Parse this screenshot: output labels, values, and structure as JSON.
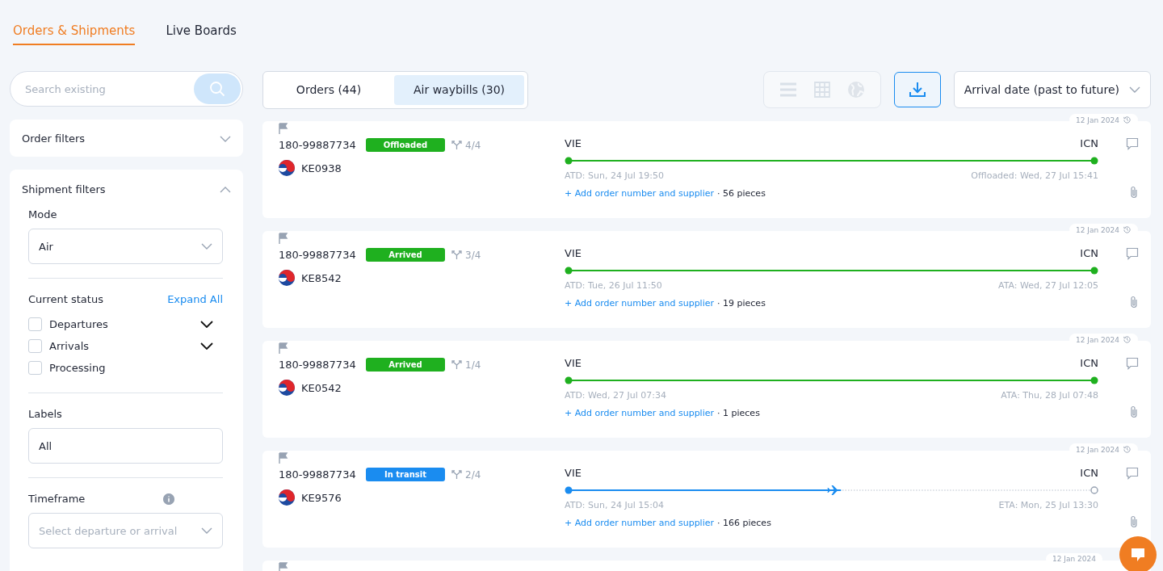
{
  "top_tabs": [
    {
      "label": "Orders & Shipments",
      "selected": true
    },
    {
      "label": "Live Boards",
      "selected": false
    }
  ],
  "search": {
    "placeholder": "Search existing"
  },
  "order_filters": {
    "title": "Order filters",
    "expanded": false
  },
  "shipment_filters": {
    "title": "Shipment filters",
    "expanded": true,
    "mode": {
      "label": "Mode",
      "value": "Air"
    },
    "current_status": {
      "label": "Current status",
      "expand_all": "Expand All",
      "options": [
        {
          "label": "Departures",
          "checked": false,
          "expandable": true
        },
        {
          "label": "Arrivals",
          "checked": false,
          "expandable": true
        },
        {
          "label": "Processing",
          "checked": false,
          "expandable": false
        }
      ]
    },
    "labels": {
      "label": "Labels",
      "value": "All"
    },
    "timeframe": {
      "label": "Timeframe",
      "placeholder": "Select departure or arrival"
    }
  },
  "view_tabs": [
    {
      "label": "Orders (44)",
      "selected": false
    },
    {
      "label": "Air waybills (30)",
      "selected": true
    }
  ],
  "sort": {
    "value": "Arrival date (past to future)"
  },
  "shipments": [
    {
      "awb": "180-99887734",
      "status": "Offloaded",
      "color": "#1fb01f",
      "legs": "4/4",
      "flight": "KE0938",
      "origin": "VIE",
      "destination": "ICN",
      "level": 1,
      "departure": "ATD: Sun, 24 Jul 19:50",
      "arrival": "Offloaded: Wed, 27 Jul 15:41",
      "add_link": "+ Add order number and supplier",
      "pieces": "· 56 pieces",
      "date": "12 Jan 2024"
    },
    {
      "awb": "180-99887734",
      "status": "Arrived",
      "color": "#1fb01f",
      "legs": "3/4",
      "flight": "KE8542",
      "origin": "VIE",
      "destination": "ICN",
      "level": 1,
      "departure": "ATD: Tue, 26 Jul 11:50",
      "arrival": "ATA: Wed, 27 Jul 12:05",
      "add_link": "+ Add order number and supplier",
      "pieces": "· 19 pieces",
      "date": "12 Jan 2024"
    },
    {
      "awb": "180-99887734",
      "status": "Arrived",
      "color": "#1fb01f",
      "legs": "1/4",
      "flight": "KE0542",
      "origin": "VIE",
      "destination": "ICN",
      "level": 1,
      "departure": "ATD: Wed, 27 Jul 07:34",
      "arrival": "ATA: Thu, 28 Jul 07:48",
      "add_link": "+ Add order number and supplier",
      "pieces": "· 1 pieces",
      "date": "12 Jan 2024"
    },
    {
      "awb": "180-99887734",
      "status": "In transit",
      "color": "#1a8cf0",
      "legs": "2/4",
      "flight": "KE9576",
      "origin": "VIE",
      "destination": "ICN",
      "level": 0.5,
      "departure": "ATD: Sun, 24 Jul 15:04",
      "arrival": "ETA: Mon, 25 Jul 13:30",
      "add_link": "+ Add order number and supplier",
      "pieces": "· 166 pieces",
      "date": "12 Jan 2024"
    }
  ],
  "partial_card": {
    "date": "12 Jan 2024"
  }
}
